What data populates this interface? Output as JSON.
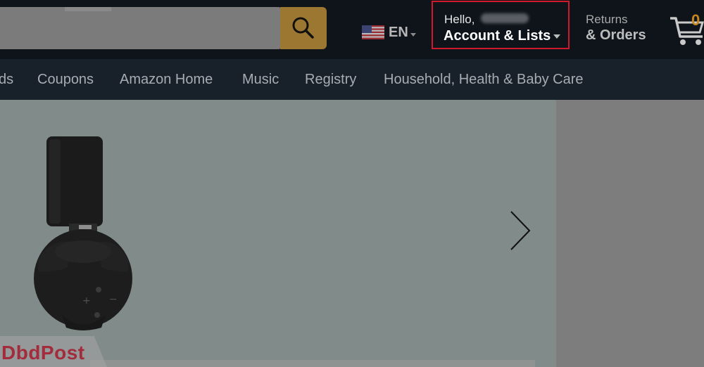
{
  "header": {
    "language": {
      "code": "EN",
      "flag": "us-flag"
    },
    "account": {
      "greeting": "Hello,",
      "label": "Account & Lists"
    },
    "returns": {
      "line1": "Returns",
      "line2": "& Orders"
    },
    "cart": {
      "count": "0"
    },
    "colors": {
      "bg": "#0f141a",
      "search_button": "#9c7732",
      "highlight_border": "#d01a2c",
      "cart_count": "#c7851e"
    }
  },
  "nav": {
    "items": [
      "ds",
      "Coupons",
      "Amazon Home",
      "Music",
      "Registry",
      "Household, Health & Baby Care"
    ]
  },
  "hero": {
    "next_icon": "chevron-right-icon"
  },
  "watermark": {
    "text": "DbdPost"
  }
}
